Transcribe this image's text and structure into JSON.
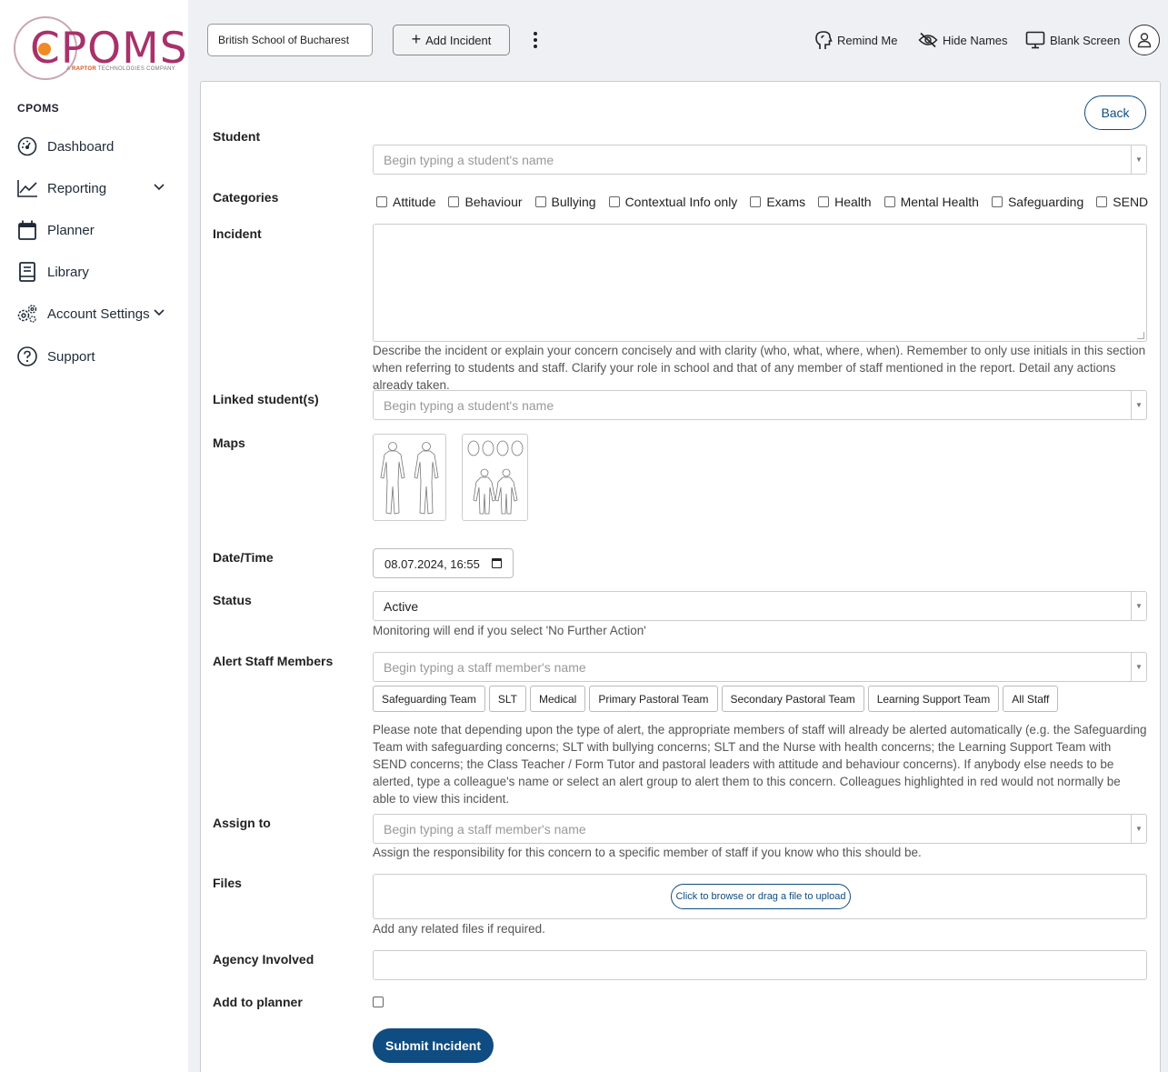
{
  "brand": {
    "logo_text": "CPOMS",
    "logo_sub_prefix": "A ",
    "logo_sub_brand": "RAPTOR",
    "logo_sub_suffix": " TECHNOLOGIES COMPANY",
    "primary_color": "#0f4c81",
    "logo_color": "#a8316a",
    "accent_color": "#f08a24"
  },
  "sidebar": {
    "heading": "CPOMS",
    "items": [
      {
        "label": "Dashboard",
        "icon": "dashboard-gauge-icon"
      },
      {
        "label": "Reporting",
        "icon": "line-chart-icon",
        "expandable": true
      },
      {
        "label": "Planner",
        "icon": "calendar-icon"
      },
      {
        "label": "Library",
        "icon": "book-icon"
      },
      {
        "label": "Account Settings",
        "icon": "settings-gears-icon",
        "expandable": true
      },
      {
        "label": "Support",
        "icon": "help-circle-icon"
      }
    ]
  },
  "topbar": {
    "school": "British School of Bucharest",
    "add_incident": "Add Incident",
    "remind_me": "Remind Me",
    "hide_names": "Hide Names",
    "blank_screen": "Blank Screen"
  },
  "form": {
    "back": "Back",
    "student_label": "Student",
    "student_placeholder": "Begin typing a student's name",
    "categories_label": "Categories",
    "categories": [
      "Attitude",
      "Behaviour",
      "Bullying",
      "Contextual Info only",
      "Exams",
      "Health",
      "Mental Health",
      "Safeguarding",
      "SEND"
    ],
    "incident_label": "Incident",
    "incident_help": "Describe the incident or explain your concern concisely and with clarity (who, what, where, when). Remember to only use initials in this section when referring to students and staff. Clarify your role in school and that of any member of staff mentioned in the report. Detail any actions already taken.",
    "linked_label": "Linked student(s)",
    "linked_placeholder": "Begin typing a student's name",
    "maps_label": "Maps",
    "datetime_label": "Date/Time",
    "datetime_value": "08.07.2024, 16:55",
    "status_label": "Status",
    "status_value": "Active",
    "status_help": "Monitoring will end if you select 'No Further Action'",
    "alert_label": "Alert Staff Members",
    "alert_placeholder": "Begin typing a staff member's name",
    "alert_groups": [
      "Safeguarding Team",
      "SLT",
      "Medical",
      "Primary Pastoral Team",
      "Secondary Pastoral Team",
      "Learning Support Team",
      "All Staff"
    ],
    "alert_help": "Please note that depending upon the type of alert, the appropriate members of staff will already be alerted automatically (e.g. the Safeguarding Team with safeguarding concerns; SLT with bullying concerns; SLT and the Nurse with health concerns; the Learning Support Team with SEND concerns; the Class Teacher / Form Tutor and pastoral leaders with attitude and behaviour concerns). If anybody else needs to be alerted, type a colleague's name or select an alert group to alert them to this concern. Colleagues highlighted in red would not normally be able to view this incident.",
    "assign_label": "Assign to",
    "assign_placeholder": "Begin typing a staff member's name",
    "assign_help": "Assign the responsibility for this concern to a specific member of staff if you know who this should be.",
    "files_label": "Files",
    "upload_text": "Click to browse or drag a file to upload",
    "files_help": "Add any related files if required.",
    "agency_label": "Agency Involved",
    "planner_label": "Add to planner",
    "submit": "Submit Incident"
  }
}
